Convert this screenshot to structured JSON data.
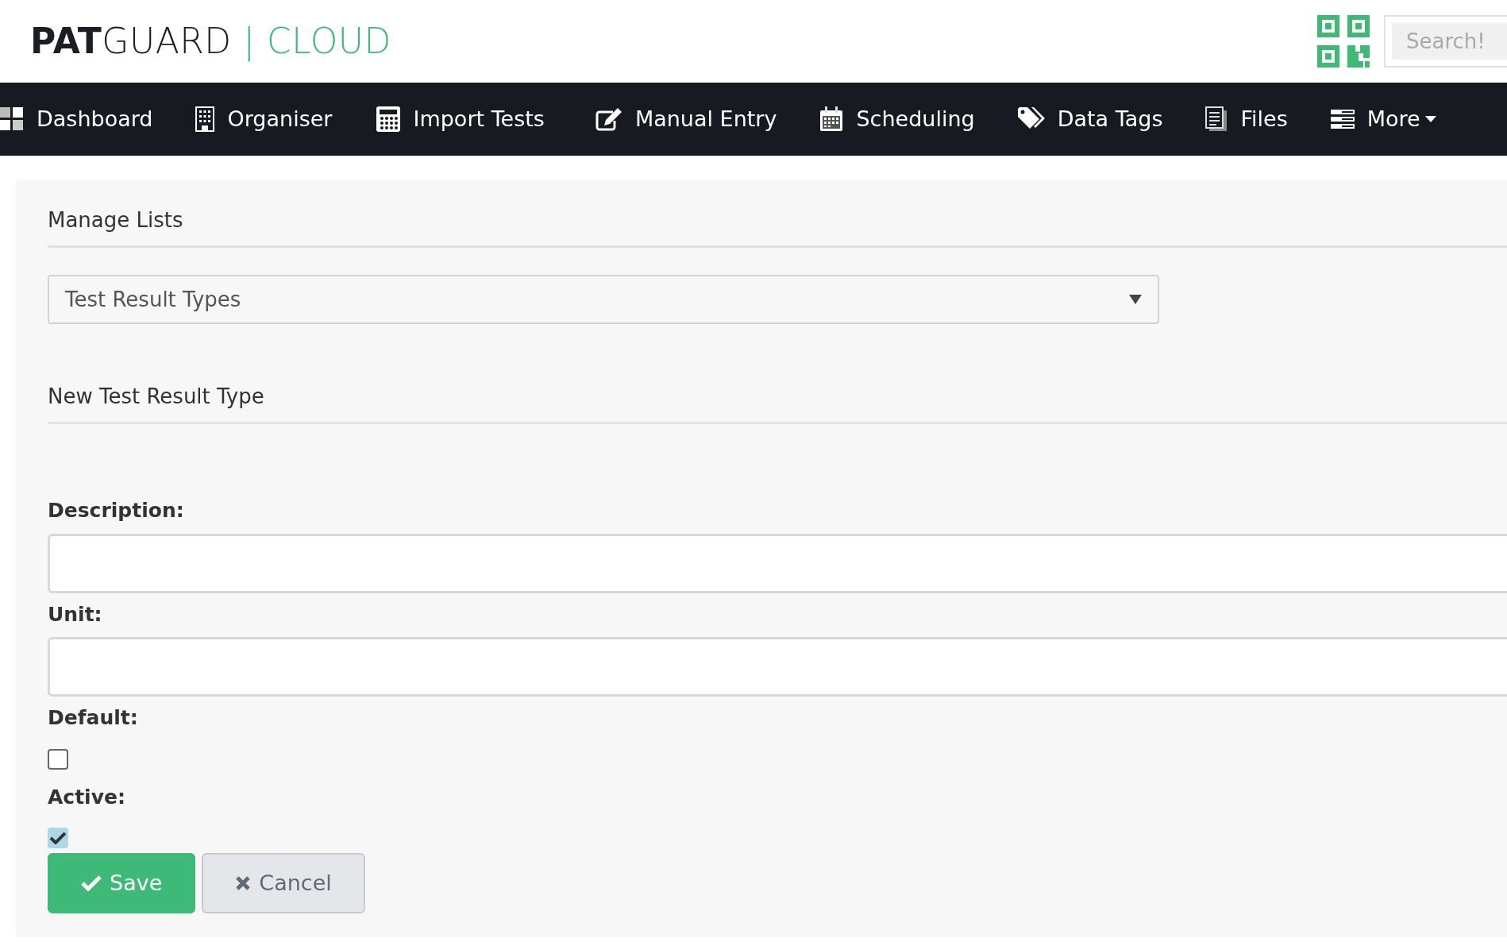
{
  "header": {
    "logo": {
      "bold": "PAT",
      "light": "GUARD",
      "separator": "|",
      "accent": "CLOUD"
    },
    "search": {
      "placeholder": "Search!"
    }
  },
  "nav": [
    {
      "label": "Dashboard",
      "kind": "tiles",
      "dropdown": false
    },
    {
      "label": "Organiser",
      "kind": "building",
      "dropdown": false
    },
    {
      "label": "Import Tests",
      "kind": "calculator",
      "dropdown": false
    },
    {
      "label": "Manual Entry",
      "kind": "edit",
      "dropdown": false
    },
    {
      "label": "Scheduling",
      "kind": "calendar",
      "dropdown": false
    },
    {
      "label": "Data Tags",
      "kind": "tags",
      "dropdown": false
    },
    {
      "label": "Files",
      "kind": "files",
      "dropdown": false
    },
    {
      "label": "More",
      "kind": "stack",
      "dropdown": true
    }
  ],
  "panel": {
    "title": "Manage Lists",
    "list_select": {
      "value": "Test Result Types"
    },
    "form_title": "New Test Result Type",
    "fields": [
      {
        "kind": "text",
        "label": "Description:"
      },
      {
        "kind": "text",
        "label": "Unit:"
      },
      {
        "kind": "checkbox",
        "label": "Default:",
        "checked": false
      },
      {
        "kind": "checkbox",
        "label": "Active:",
        "checked": true
      }
    ],
    "buttons": [
      {
        "label": "Save",
        "kind": "primary"
      },
      {
        "label": "Cancel",
        "kind": "secondary"
      }
    ]
  }
}
